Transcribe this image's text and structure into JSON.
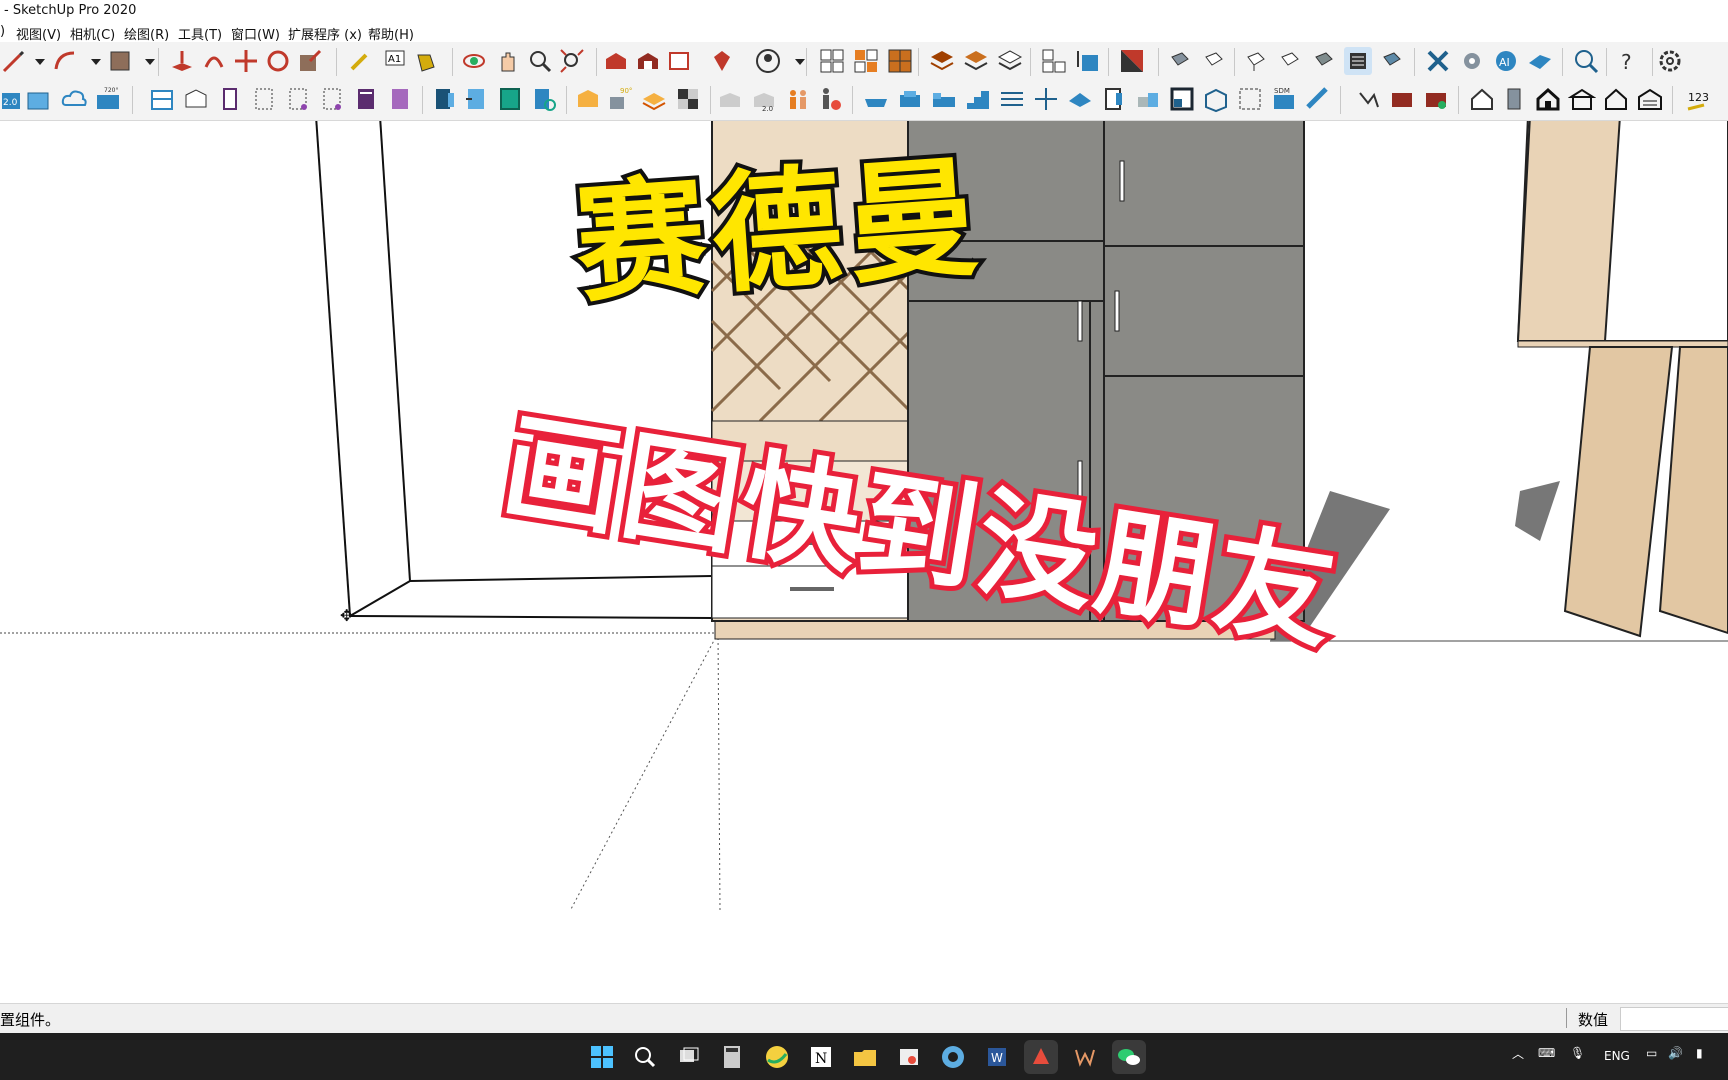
{
  "window": {
    "title": "- SketchUp Pro 2020"
  },
  "menu": {
    "items": [
      "视图(V)",
      "相机(C)",
      "绘图(R)",
      "工具(T)",
      "窗口(W)",
      "扩展程序 (x)",
      "帮助(H)"
    ]
  },
  "toolbar_labels": {
    "a1": "A1",
    "deg90": "90°",
    "sdm": "SDM",
    "n123": "123",
    "v20": "2.0",
    "v720": "720°"
  },
  "overlay": {
    "headline": "赛德曼",
    "subhead": "画图快到没朋友"
  },
  "status": {
    "hint": "置组件。",
    "measure_label": "数值"
  },
  "tray": {
    "lang": "ENG"
  },
  "colors": {
    "headline_fill": "#ffe600",
    "subhead_fill": "#ffffff",
    "subhead_stroke": "#e8213a",
    "cabinet_gray": "#8a8a86",
    "wood": "#e9d3b6"
  }
}
